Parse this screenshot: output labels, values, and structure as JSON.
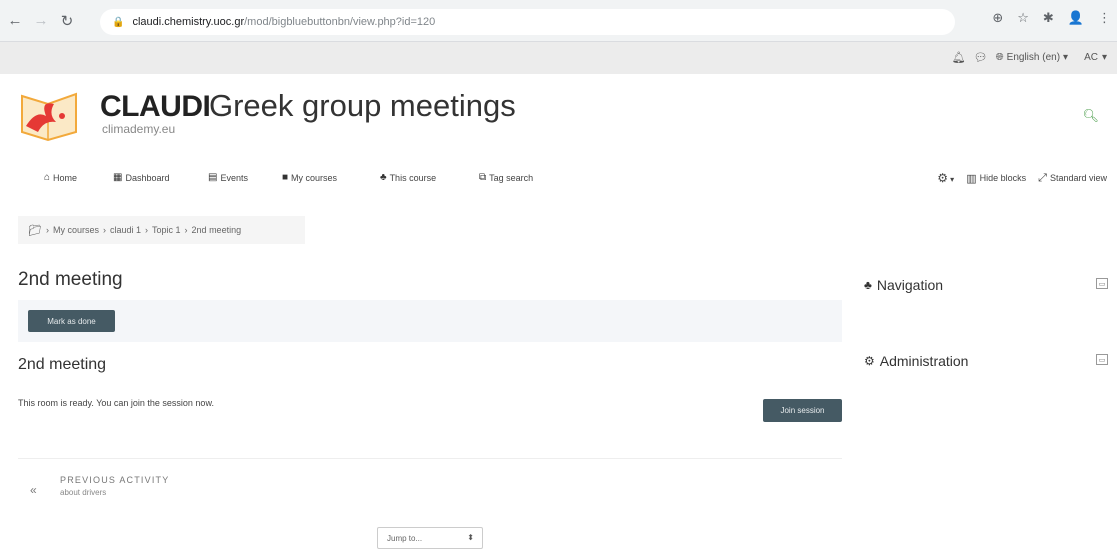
{
  "browser": {
    "url_host": "claudi.chemistry.uoc.gr",
    "url_path": "/mod/bigbluebuttonbn/view.php?id=120"
  },
  "user_bar": {
    "language": "English (en)",
    "user_initials": "AC"
  },
  "header": {
    "brand_name": "CLAUDI",
    "brand_sub": "climademy.eu",
    "site_title": "Greek group meetings"
  },
  "navbar": {
    "items": [
      {
        "label": "Home"
      },
      {
        "label": "Dashboard"
      },
      {
        "label": "Events"
      },
      {
        "label": "My courses"
      },
      {
        "label": "This course"
      },
      {
        "label": "Tag search"
      }
    ],
    "hide_blocks": "Hide blocks",
    "standard_view": "Standard view"
  },
  "breadcrumb": {
    "items": [
      "My courses",
      "claudi 1",
      "Topic 1",
      "2nd meeting"
    ]
  },
  "main": {
    "page_title": "2nd meeting",
    "mark_done_label": "Mark as done",
    "section_title": "2nd meeting",
    "room_status": "This room is ready. You can join the session now.",
    "join_label": "Join session",
    "prev_activity_label": "PREVIOUS ACTIVITY",
    "prev_activity_name": "about drivers",
    "jump_to_label": "Jump to..."
  },
  "blocks": {
    "navigation": "Navigation",
    "administration": "Administration"
  },
  "colors": {
    "button_bg": "#455a64",
    "accent_green": "#51a151"
  }
}
